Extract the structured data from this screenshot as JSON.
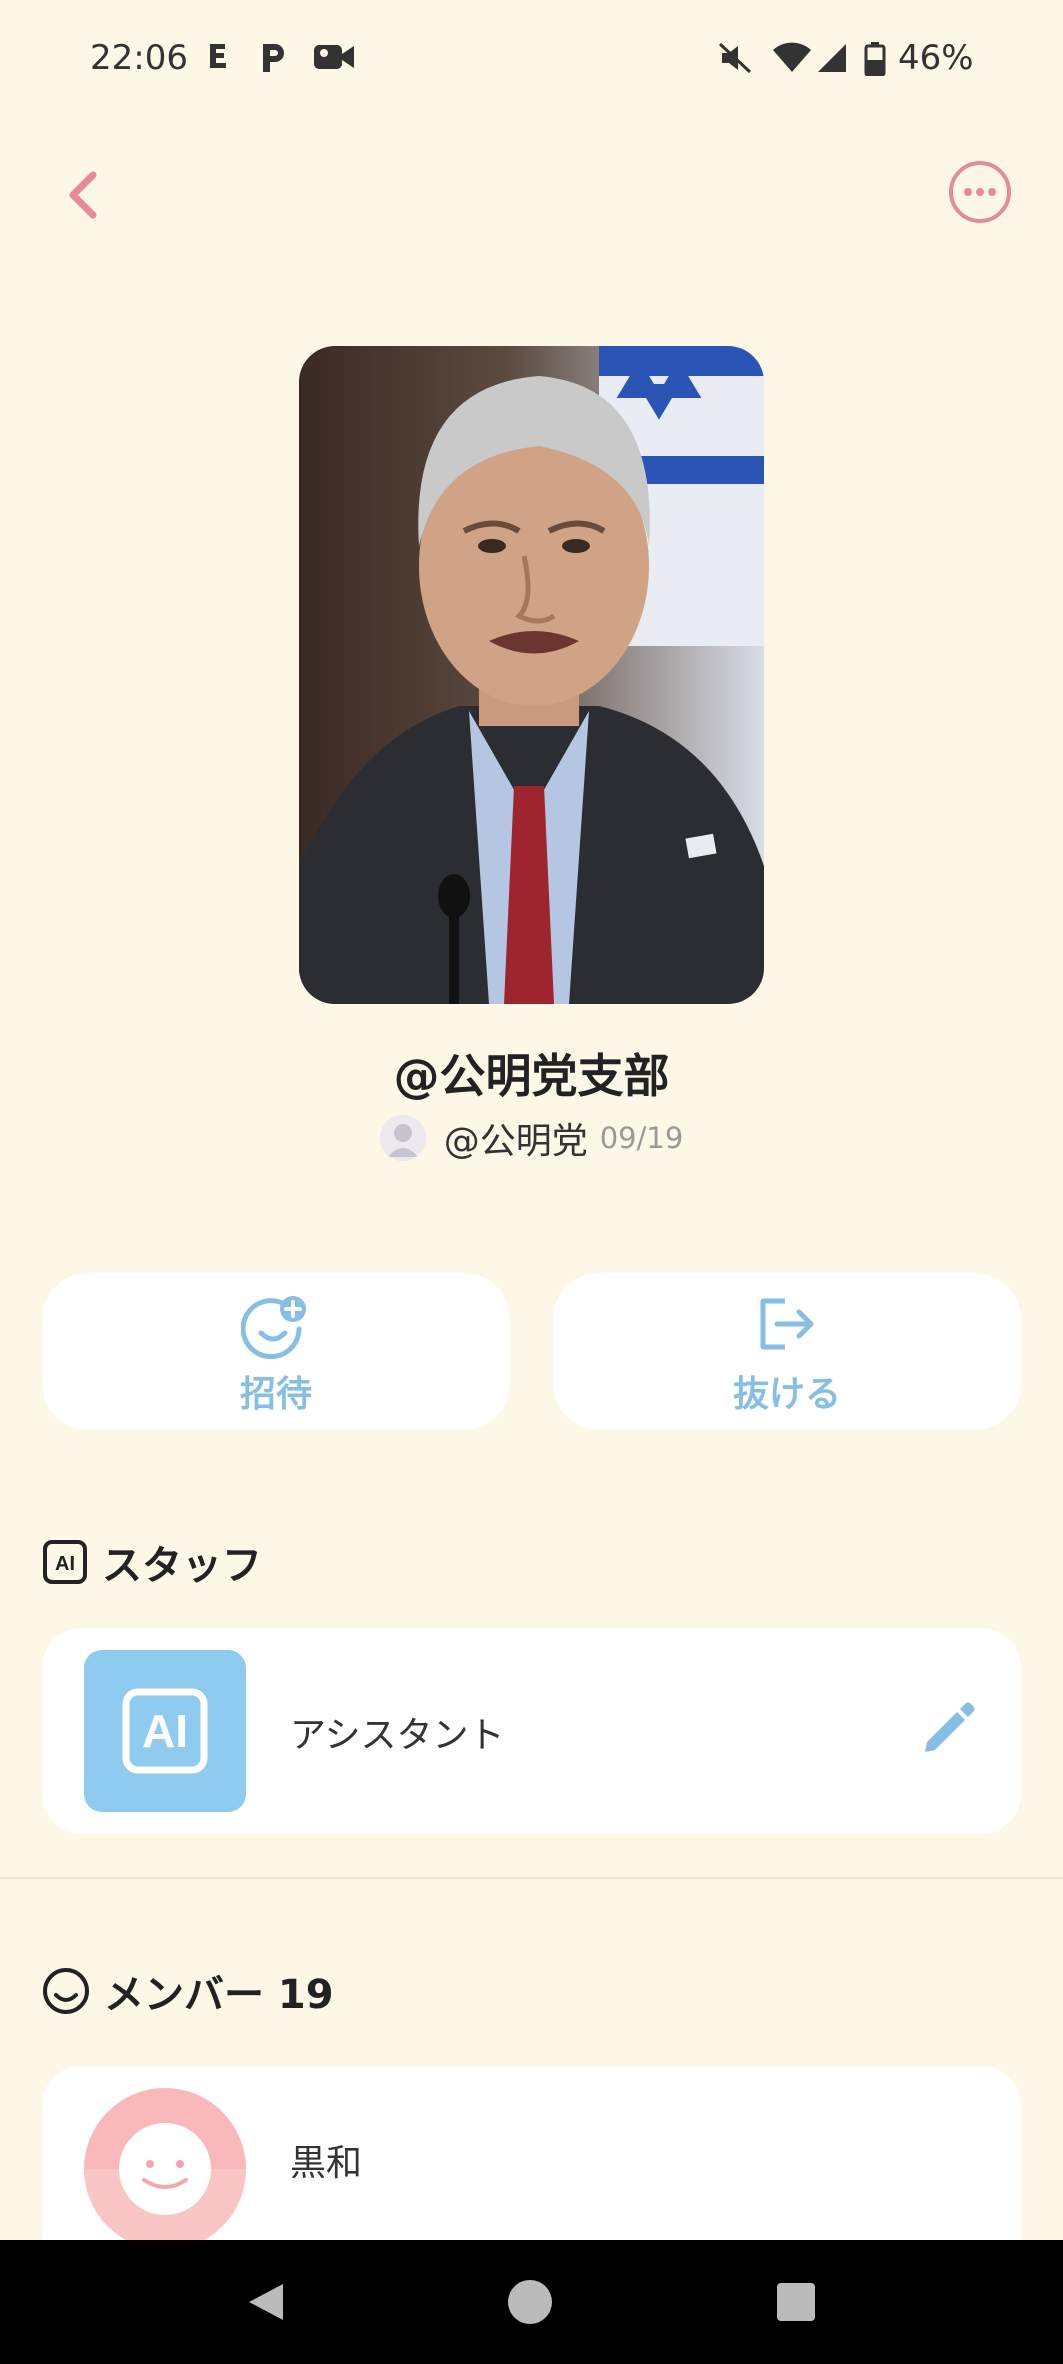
{
  "status_bar": {
    "time": "22:06",
    "notification_icons": [
      "e-icon",
      "p-icon",
      "video-camera-icon"
    ],
    "system_icons": [
      "mute-icon",
      "wifi-icon",
      "signal-icon",
      "battery-icon"
    ],
    "battery": "46%"
  },
  "header": {
    "back_icon": "chevron-left-icon",
    "more_icon": "more-horizontal-circle-icon"
  },
  "group": {
    "title": "@公明党支部",
    "creator_name": "@公明党",
    "created_date": "09/19"
  },
  "actions": {
    "invite_label": "招待",
    "leave_label": "抜ける"
  },
  "staff_section": {
    "header": "スタッフ",
    "items": [
      {
        "name": "アシスタント",
        "tile_text": "AI"
      }
    ]
  },
  "members_section": {
    "header": "メンバー 19",
    "items": [
      {
        "name": "黒和"
      }
    ]
  },
  "colors": {
    "background": "#fdf7e8",
    "accent_pink": "#e88a98",
    "accent_blue": "#85bfe6"
  }
}
